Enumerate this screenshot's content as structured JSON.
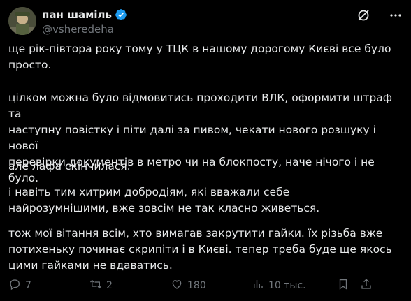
{
  "author": {
    "display_name": "пан шаміль",
    "handle": "@vsheredeha"
  },
  "tweet": {
    "paragraphs": [
      "ще рік-півтора року тому у ТЦК в нашому дорогому Києві все було\nпросто.",
      "цілком можна було відмовитись проходити ВЛК, оформити штраф та\nнаступну повістку і піти далі за пивом, чекати нового розшуку і нової\nперевірки документів в метро чи на блокпосту, наче нічого і не було.",
      "але лафа скінчилася.",
      "і навіть тим хитрим добродіям, які вважали себе\nнайрозумнішими, вже зовсім не так класно живеться.",
      "тож мої вітання всім, хто вимагав закрутити гайки. їх різьба вже\nпотихеньку починає скрипіти і в Києві. тепер треба буде ще якось\nцими гайками не вдаватись."
    ]
  },
  "metrics": {
    "replies": "7",
    "reposts": "2",
    "likes": "180",
    "views": "10 тыс."
  },
  "colors": {
    "background": "#000000",
    "text": "#e7e9ea",
    "muted": "#71767b",
    "verified": "#1d9bf0"
  },
  "icons": {
    "verified": "verified-badge-icon",
    "grok": "grok-icon",
    "more": "more-dots-icon",
    "reply": "reply-icon",
    "repost": "repost-icon",
    "like": "heart-icon",
    "views": "views-bar-chart-icon",
    "bookmark": "bookmark-icon",
    "share": "share-icon"
  }
}
